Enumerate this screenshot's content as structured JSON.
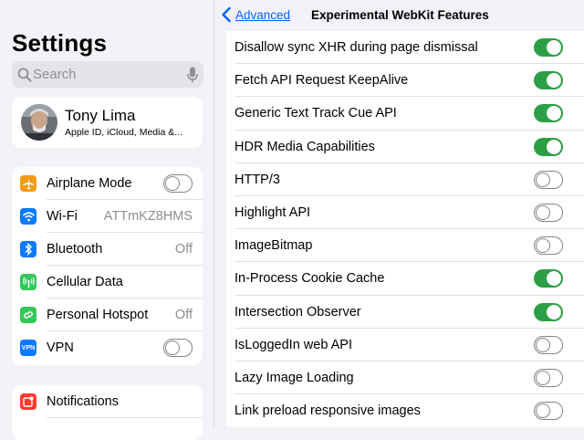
{
  "sidebar": {
    "title": "Settings",
    "search_placeholder": "Search",
    "profile": {
      "name": "Tony Lima",
      "subtitle": "Apple ID, iCloud, Media &..."
    },
    "items": [
      {
        "label": "Airplane Mode",
        "icon": "airplane-icon",
        "color": "#f39c12",
        "toggle": "off"
      },
      {
        "label": "Wi-Fi",
        "icon": "wifi-icon",
        "color": "#0a7aff",
        "value": "ATTmKZ8HMS"
      },
      {
        "label": "Bluetooth",
        "icon": "bluetooth-icon",
        "color": "#0a7aff",
        "value": "Off"
      },
      {
        "label": "Cellular Data",
        "icon": "antenna-icon",
        "color": "#34c759"
      },
      {
        "label": "Personal Hotspot",
        "icon": "hotspot-icon",
        "color": "#34c759",
        "value": "Off"
      },
      {
        "label": "VPN",
        "icon": "vpn-icon",
        "color": "#0a7aff",
        "toggle": "off"
      }
    ],
    "notifications": {
      "label": "Notifications",
      "icon": "notifications-icon",
      "color": "#ff3b30"
    }
  },
  "navbar": {
    "back_label": "Advanced",
    "title": "Experimental WebKit Features"
  },
  "features": [
    {
      "label": "Disallow sync XHR during page dismissal",
      "on": true
    },
    {
      "label": "Fetch API Request KeepAlive",
      "on": true
    },
    {
      "label": "Generic Text Track Cue API",
      "on": true
    },
    {
      "label": "HDR Media Capabilities",
      "on": true
    },
    {
      "label": "HTTP/3",
      "on": false
    },
    {
      "label": "Highlight API",
      "on": false
    },
    {
      "label": "ImageBitmap",
      "on": false
    },
    {
      "label": "In-Process Cookie Cache",
      "on": true
    },
    {
      "label": "Intersection Observer",
      "on": true
    },
    {
      "label": "IsLoggedIn web API",
      "on": false
    },
    {
      "label": "Lazy Image Loading",
      "on": false
    },
    {
      "label": "Link preload responsive images",
      "on": false
    }
  ],
  "colors": {
    "accent": "#0a60ff",
    "toggle_on": "#2c9e45",
    "toggle_off_border": "#858589"
  }
}
